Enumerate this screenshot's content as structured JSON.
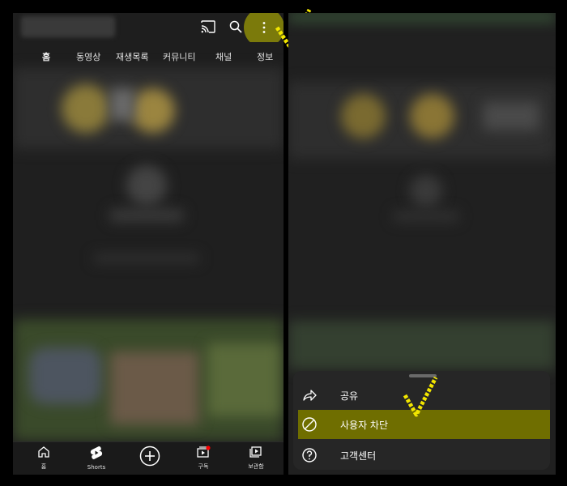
{
  "left_screen": {
    "tabs": [
      {
        "label": "홈",
        "active": true
      },
      {
        "label": "동영상",
        "active": false
      },
      {
        "label": "재생목록",
        "active": false
      },
      {
        "label": "커뮤니티",
        "active": false
      },
      {
        "label": "채널",
        "active": false
      },
      {
        "label": "정보",
        "active": false
      }
    ],
    "toolbar_icons": [
      "cast-icon",
      "search-icon",
      "more-vert-icon"
    ],
    "bottom_nav": [
      {
        "label": "홈",
        "icon": "home-icon"
      },
      {
        "label": "Shorts",
        "icon": "shorts-icon"
      },
      {
        "label": "",
        "icon": "create-plus-icon"
      },
      {
        "label": "구독",
        "icon": "subscriptions-icon"
      },
      {
        "label": "보관함",
        "icon": "library-icon"
      }
    ]
  },
  "right_screen": {
    "menu": [
      {
        "label": "공유",
        "icon": "share-icon",
        "highlighted": false
      },
      {
        "label": "사용자 차단",
        "icon": "block-icon",
        "highlighted": true
      },
      {
        "label": "고객센터",
        "icon": "help-icon",
        "highlighted": false
      }
    ]
  },
  "colors": {
    "highlight": "#6f6e00",
    "checkmark": "#f2e600",
    "notification_dot": "#ff0000"
  }
}
